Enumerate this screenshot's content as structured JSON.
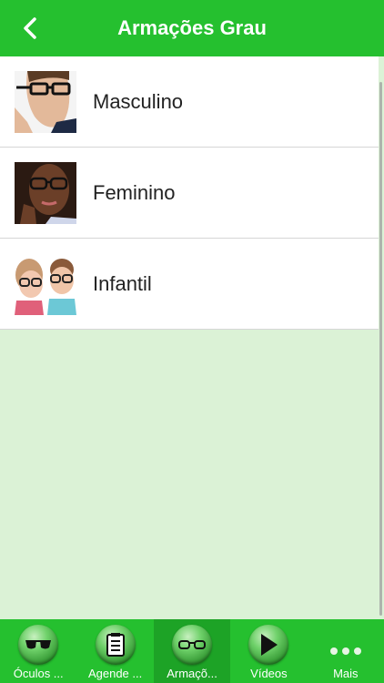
{
  "header": {
    "title": "Armações Grau",
    "back_icon": "chevron-left-icon"
  },
  "categories": [
    {
      "label": "Masculino",
      "image": "man-with-glasses-photo"
    },
    {
      "label": "Feminino",
      "image": "woman-with-glasses-photo"
    },
    {
      "label": "Infantil",
      "image": "kids-with-glasses-photo"
    }
  ],
  "tabbar": {
    "tabs": [
      {
        "label": "Óculos ...",
        "icon": "sunglasses-icon",
        "active": false
      },
      {
        "label": "Agende ...",
        "icon": "calendar-list-icon",
        "active": false
      },
      {
        "label": "Armaçõ...",
        "icon": "eyeglasses-icon",
        "active": true
      },
      {
        "label": "Vídeos",
        "icon": "play-icon",
        "active": false
      },
      {
        "label": "Mais",
        "icon": "more-dots-icon",
        "active": false
      }
    ]
  },
  "colors": {
    "primary": "#25c02f",
    "active_tab": "#1da326",
    "background": "#dbf2d6",
    "text": "#222222"
  }
}
